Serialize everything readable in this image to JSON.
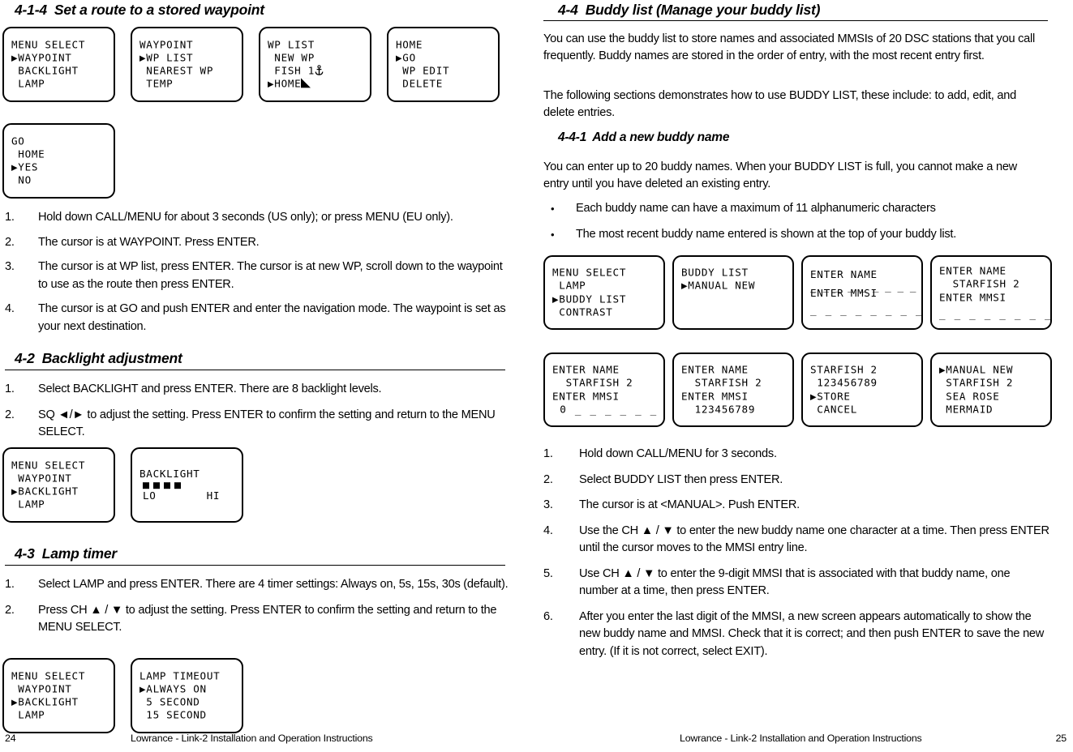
{
  "left_page": {
    "heading_4_1_4": {
      "num": "4-1-4",
      "text": "Set a route to a stored waypoint"
    },
    "lcd_row1": [
      {
        "lines": [
          "MENU SELECT",
          "▶WAYPOINT",
          " BACKLIGHT",
          " LAMP"
        ]
      },
      {
        "lines": [
          "WAYPOINT",
          "▶WP LIST",
          " NEAREST WP",
          " TEMP"
        ]
      },
      {
        "lines": [
          "WP LIST",
          " NEW WP",
          " FISH 1",
          "▶HOME"
        ]
      },
      {
        "lines": [
          "HOME",
          "▶GO",
          " WP EDIT",
          " DELETE"
        ]
      }
    ],
    "lcd_row2": [
      {
        "lines": [
          "GO",
          " HOME",
          "▶YES",
          " NO"
        ]
      }
    ],
    "steps_4_1_4": [
      {
        "n": "1.",
        "t": "Hold down CALL/MENU for about 3 seconds (US only); or press MENU (EU only)."
      },
      {
        "n": "2.",
        "t": "The cursor is at WAYPOINT. Press ENTER."
      },
      {
        "n": "3.",
        "t": "The cursor is at WP list, press ENTER.  The cursor is at new WP, scroll down to the waypoint to use as the route then press ENTER."
      },
      {
        "n": "4.",
        "t": "The cursor is at GO and push ENTER and enter the navigation mode.  The waypoint is set as your next destination."
      }
    ],
    "heading_4_2": {
      "num": "4-2",
      "text": "Backlight adjustment"
    },
    "steps_4_2": [
      {
        "n": "1.",
        "t": "Select BACKLIGHT and press ENTER. There are 8 backlight levels."
      },
      {
        "n": "2.",
        "t": "SQ ◄/► to adjust the setting. Press ENTER to confirm the setting and return to the MENU SELECT."
      }
    ],
    "lcd_backlight": [
      {
        "lines": [
          "MENU SELECT",
          " WAYPOINT",
          "▶BACKLIGHT",
          " LAMP"
        ]
      },
      {
        "title": "BACKLIGHT",
        "squares": 4,
        "lo": "LO",
        "hi": "HI"
      }
    ],
    "heading_4_3": {
      "num": "4-3",
      "text": "Lamp timer"
    },
    "steps_4_3": [
      {
        "n": "1.",
        "t": "Select LAMP and press ENTER. There are 4 timer settings: Always on, 5s, 15s, 30s (default)."
      },
      {
        "n": "2.",
        "t": "Press CH ▲ / ▼ to adjust the setting. Press ENTER to confirm the setting and return to the MENU SELECT."
      }
    ],
    "lcd_lamp": [
      {
        "lines": [
          "MENU SELECT",
          " WAYPOINT",
          "▶BACKLIGHT",
          " LAMP"
        ]
      },
      {
        "lines": [
          "LAMP TIMEOUT",
          "▶ALWAYS ON",
          " 5 SECOND",
          " 15 SECOND"
        ]
      }
    ],
    "footer": {
      "page": "24",
      "text": "Lowrance - Link-2 Installation and Operation Instructions"
    }
  },
  "right_page": {
    "heading_4_4": {
      "num": "4-4",
      "text": "Buddy list (Manage your buddy list)"
    },
    "para1": "You can use the buddy list to store names and associated MMSIs of 20 DSC stations that you call frequently. Buddy names are stored in the order of entry, with the most recent entry first.",
    "para2": "The following sections demonstrates how to use BUDDY LIST, these include: to add, edit, and delete entries.",
    "heading_4_4_1": {
      "num": "4-4-1",
      "text": "Add a new buddy name"
    },
    "para3": "You can enter up to 20 buddy names. When your BUDDY LIST is full, you cannot make a new entry until you have deleted an existing entry.",
    "bullets": [
      "Each buddy name can have a maximum of 11 alphanumeric characters",
      "The most recent buddy name entered is shown at the top of your buddy list."
    ],
    "lcd_row1": [
      {
        "lines": [
          "MENU SELECT",
          " LAMP",
          "▶BUDDY LIST",
          " CONTRAST"
        ]
      },
      {
        "lines": [
          "BUDDY LIST",
          "▶MANUAL NEW",
          "",
          ""
        ]
      },
      {
        "lines": [
          "ENTER NAME",
          "_ _ _ _ _ _ _ _ _ _ _",
          "ENTER MMSI",
          "_ _ _ _ _ _ _ _ _"
        ],
        "overlay": true
      },
      {
        "lines": [
          "ENTER NAME",
          "  STARFISH 2",
          "ENTER MMSI",
          "_ _ _ _ _ _ _ _ _"
        ]
      }
    ],
    "lcd_row2": [
      {
        "lines": [
          "ENTER NAME",
          "  STARFISH 2",
          "ENTER MMSI",
          " 0 _ _ _ _ _ _ _"
        ]
      },
      {
        "lines": [
          "ENTER NAME",
          "  STARFISH 2",
          "ENTER MMSI",
          "  123456789"
        ]
      },
      {
        "lines": [
          "STARFISH 2",
          " 123456789",
          "▶STORE",
          " CANCEL"
        ]
      },
      {
        "lines": [
          "▶MANUAL NEW",
          " STARFISH 2",
          " SEA ROSE",
          " MERMAID"
        ]
      }
    ],
    "steps": [
      {
        "n": "1.",
        "t": "Hold down CALL/MENU for 3 seconds."
      },
      {
        "n": "2.",
        "t": "Select BUDDY LIST then press ENTER."
      },
      {
        "n": "3.",
        "t": "The cursor is at <MANUAL>. Push ENTER."
      },
      {
        "n": "4.",
        "t": "Use the CH ▲ / ▼ to enter the new buddy name one character at a time. Then press ENTER until the cursor moves to the MMSI entry line."
      },
      {
        "n": "5.",
        "t": "Use CH ▲ / ▼ to enter the 9-digit MMSI that is associated with that buddy name, one number at a time, then press ENTER."
      },
      {
        "n": "6.",
        "t": "After you enter the last digit of the MMSI, a new screen appears automatically to show the new buddy name and MMSI. Check that it is correct; and then push ENTER to save the new entry. (If it is not correct, select EXIT)."
      }
    ],
    "footer": {
      "page": "25",
      "text": "Lowrance - Link-2 Installation and Operation Instructions"
    }
  },
  "icons": {
    "anchor": "anchor-icon",
    "home_flag": "home-flag-icon",
    "cursor_arrow": "▶"
  }
}
